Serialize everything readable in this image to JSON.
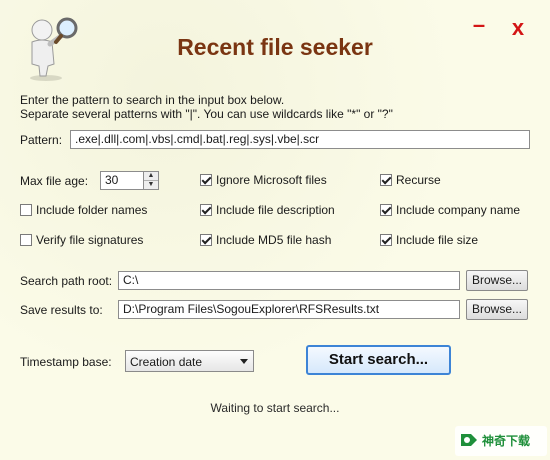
{
  "window": {
    "title": "Recent file seeker",
    "minimize_glyph": "–",
    "close_glyph": "x"
  },
  "intro": {
    "line1": "Enter the pattern to search in the input box below.",
    "line2": "Separate several patterns with \"|\". You can use wildcards like \"*\" or \"?\""
  },
  "pattern": {
    "label": "Pattern:",
    "value": ".exe|.dll|.com|.vbs|.cmd|.bat|.reg|.sys|.vbe|.scr"
  },
  "max_age": {
    "label": "Max file age:",
    "value": "30"
  },
  "options": {
    "ignore_ms": {
      "label": "Ignore Microsoft files",
      "checked": true
    },
    "recurse": {
      "label": "Recurse",
      "checked": true
    },
    "include_folders": {
      "label": "Include folder names",
      "checked": false
    },
    "include_description": {
      "label": "Include file description",
      "checked": true
    },
    "include_company": {
      "label": "Include company name",
      "checked": true
    },
    "verify_signatures": {
      "label": "Verify file signatures",
      "checked": false
    },
    "include_md5": {
      "label": "Include MD5 file hash",
      "checked": true
    },
    "include_size": {
      "label": "Include file size",
      "checked": true
    }
  },
  "search_root": {
    "label": "Search path root:",
    "value": "C:\\",
    "browse": "Browse..."
  },
  "save_results": {
    "label": "Save results to:",
    "value": "D:\\Program Files\\SogouExplorer\\RFSResults.txt",
    "browse": "Browse..."
  },
  "timestamp": {
    "label": "Timestamp base:",
    "selected": "Creation date"
  },
  "start_button": "Start search...",
  "status": "Waiting to start search...",
  "watermark": {
    "text": "神奇下载",
    "accent": "#1f8f3a"
  },
  "colors": {
    "title": "#7a3512",
    "window_controls": "#d31515",
    "start_border": "#3d84d6"
  }
}
